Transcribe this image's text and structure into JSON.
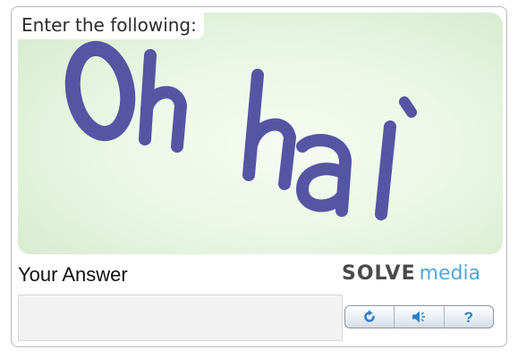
{
  "captcha": {
    "instruction": "Enter the following:",
    "challenge_text": "Oh hai",
    "glyph_color": "#5555a4"
  },
  "answer": {
    "label": "Your Answer",
    "value": "",
    "placeholder": ""
  },
  "brand": {
    "solve": "SOLVE",
    "media": "media",
    "solve_color": "#4a4a4a",
    "media_color": "#4fa8d6"
  },
  "controls": {
    "refresh_icon": "refresh-icon",
    "audio_icon": "speaker-icon",
    "help_icon": "help-icon",
    "help_glyph": "?"
  }
}
